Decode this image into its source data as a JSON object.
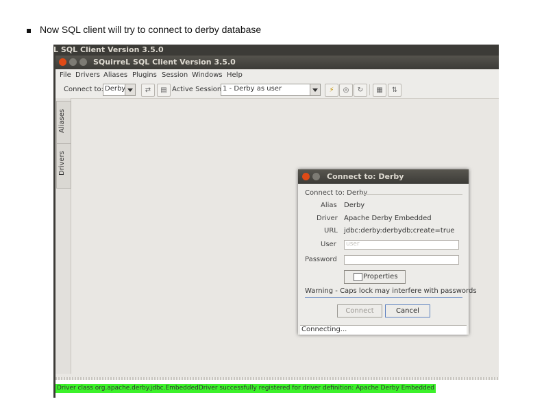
{
  "slide": {
    "bullet_text": "Now SQL client will try to connect to derby database"
  },
  "app": {
    "outer_title": "L SQL Client Version 3.5.0",
    "window_title": "SQuirreL SQL Client Version 3.5.0",
    "menu": [
      "File",
      "Drivers",
      "Aliases",
      "Plugins",
      "Session",
      "Windows",
      "Help"
    ],
    "toolbar": {
      "connect_to_label": "Connect to:",
      "connect_to_value": "Derby",
      "active_session_label": "Active Session",
      "active_session_value": "1 - Derby  as user"
    },
    "side_tabs": [
      "Aliases",
      "Drivers"
    ]
  },
  "dialog": {
    "title": "Connect to: Derby",
    "heading": "Connect to: Derby",
    "alias_label": "Alias",
    "alias_value": "Derby",
    "driver_label": "Driver",
    "driver_value": "Apache Derby Embedded",
    "url_label": "URL",
    "url_value": "jdbc:derby:derbydb;create=true",
    "user_label": "User",
    "user_value": "user",
    "password_label": "Password",
    "password_value": "",
    "properties_button": "Properties",
    "warning": "Warning - Caps lock may interfere with passwords",
    "connect_button": "Connect",
    "cancel_button": "Cancel",
    "status": "Connecting..."
  },
  "log": {
    "message": "Driver class org.apache.derby.jdbc.EmbeddedDriver successfully registered for driver definition: Apache Derby Embedded",
    "highlight_color": "#3cf22a"
  },
  "colors": {
    "title_bar": "#3c3b37",
    "close_button": "#df4a16",
    "window_background": "#e9e7e3"
  }
}
